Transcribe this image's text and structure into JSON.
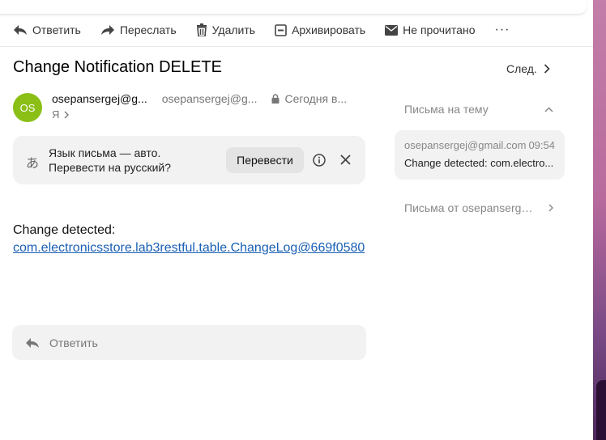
{
  "toolbar": {
    "reply": "Ответить",
    "forward": "Переслать",
    "delete": "Удалить",
    "archive": "Архивировать",
    "unread": "Не прочитано",
    "more": "···"
  },
  "message": {
    "subject": "Change Notification DELETE",
    "next_label": "След.",
    "avatar_initials": "OS",
    "avatar_color": "#8bbf16",
    "sender_name": "osepansergej@g...",
    "sender_email": "osepansergej@g...",
    "date": "Сегодня в...",
    "recipient": "Я",
    "body_text": "Change detected:",
    "body_link": "com.electronicsstore.lab3restful.table.ChangeLog@669f0580"
  },
  "translate": {
    "icon": "あ",
    "line1": "Язык письма — авто.",
    "line2": "Перевести на русский?",
    "button": "Перевести"
  },
  "reply_box": {
    "label": "Ответить"
  },
  "sidebar": {
    "thread_title": "Письма на тему",
    "thread_item": {
      "email": "osepansergej@gmail.com",
      "time": "09:54",
      "subject": "Change detected: com.electro..."
    },
    "from_letters": "Письма от osepansergej..."
  },
  "colors": {
    "link": "#1a5fb4",
    "background": "#ffffff"
  }
}
